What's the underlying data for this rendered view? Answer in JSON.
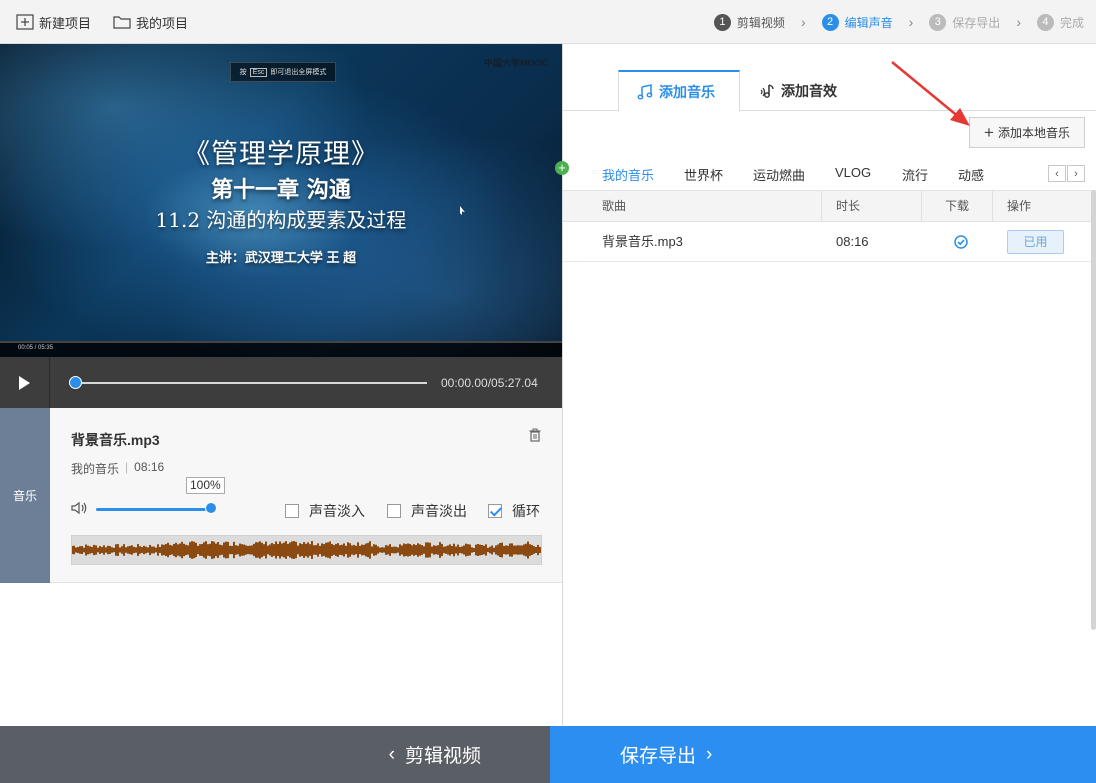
{
  "topbar": {
    "new_project": "新建项目",
    "my_projects": "我的项目",
    "steps": [
      {
        "num": "1",
        "label": "剪辑视频"
      },
      {
        "num": "2",
        "label": "编辑声音"
      },
      {
        "num": "3",
        "label": "保存导出"
      },
      {
        "num": "4",
        "label": "完成"
      }
    ]
  },
  "video": {
    "esc_hint_prefix": "按",
    "esc_key": "Esc",
    "esc_hint_suffix": "即可退出全屏模式",
    "logo": "中国大学MOOC",
    "title1": "《管理学原理》",
    "title2": "第十一章  沟通",
    "title3": "11.2 沟通的构成要素及过程",
    "speaker": "主讲：武汉理工大学  王  超",
    "mini_time": "00:05 / 05:35"
  },
  "player": {
    "timecode": "00:00.00/05:27.04",
    "seek_progress": 0.0
  },
  "music_panel": {
    "tab_label": "音乐",
    "file_name": "背景音乐.mp3",
    "source": "我的音乐",
    "duration": "08:16",
    "volume_label": "100%",
    "volume": 1.0,
    "fade_in_label": "声音淡入",
    "fade_in": false,
    "fade_out_label": "声音淡出",
    "fade_out": false,
    "loop_label": "循环",
    "loop": true,
    "waveform_color": "#8a4a12"
  },
  "right": {
    "tab_music": "添加音乐",
    "tab_effects": "添加音效",
    "add_local_label": "添加本地音乐",
    "categories": [
      "我的音乐",
      "世界杯",
      "运动燃曲",
      "VLOG",
      "流行",
      "动感"
    ],
    "table": {
      "headers": [
        "歌曲",
        "时长",
        "下载",
        "操作"
      ],
      "rows": [
        {
          "name": "背景音乐.mp3",
          "duration": "08:16",
          "action": "已用"
        }
      ]
    }
  },
  "bottom": {
    "back_label": "剪辑视频",
    "next_label": "保存导出"
  },
  "colors": {
    "accent": "#2b8ee8",
    "annotation_arrow": "#e53935"
  }
}
